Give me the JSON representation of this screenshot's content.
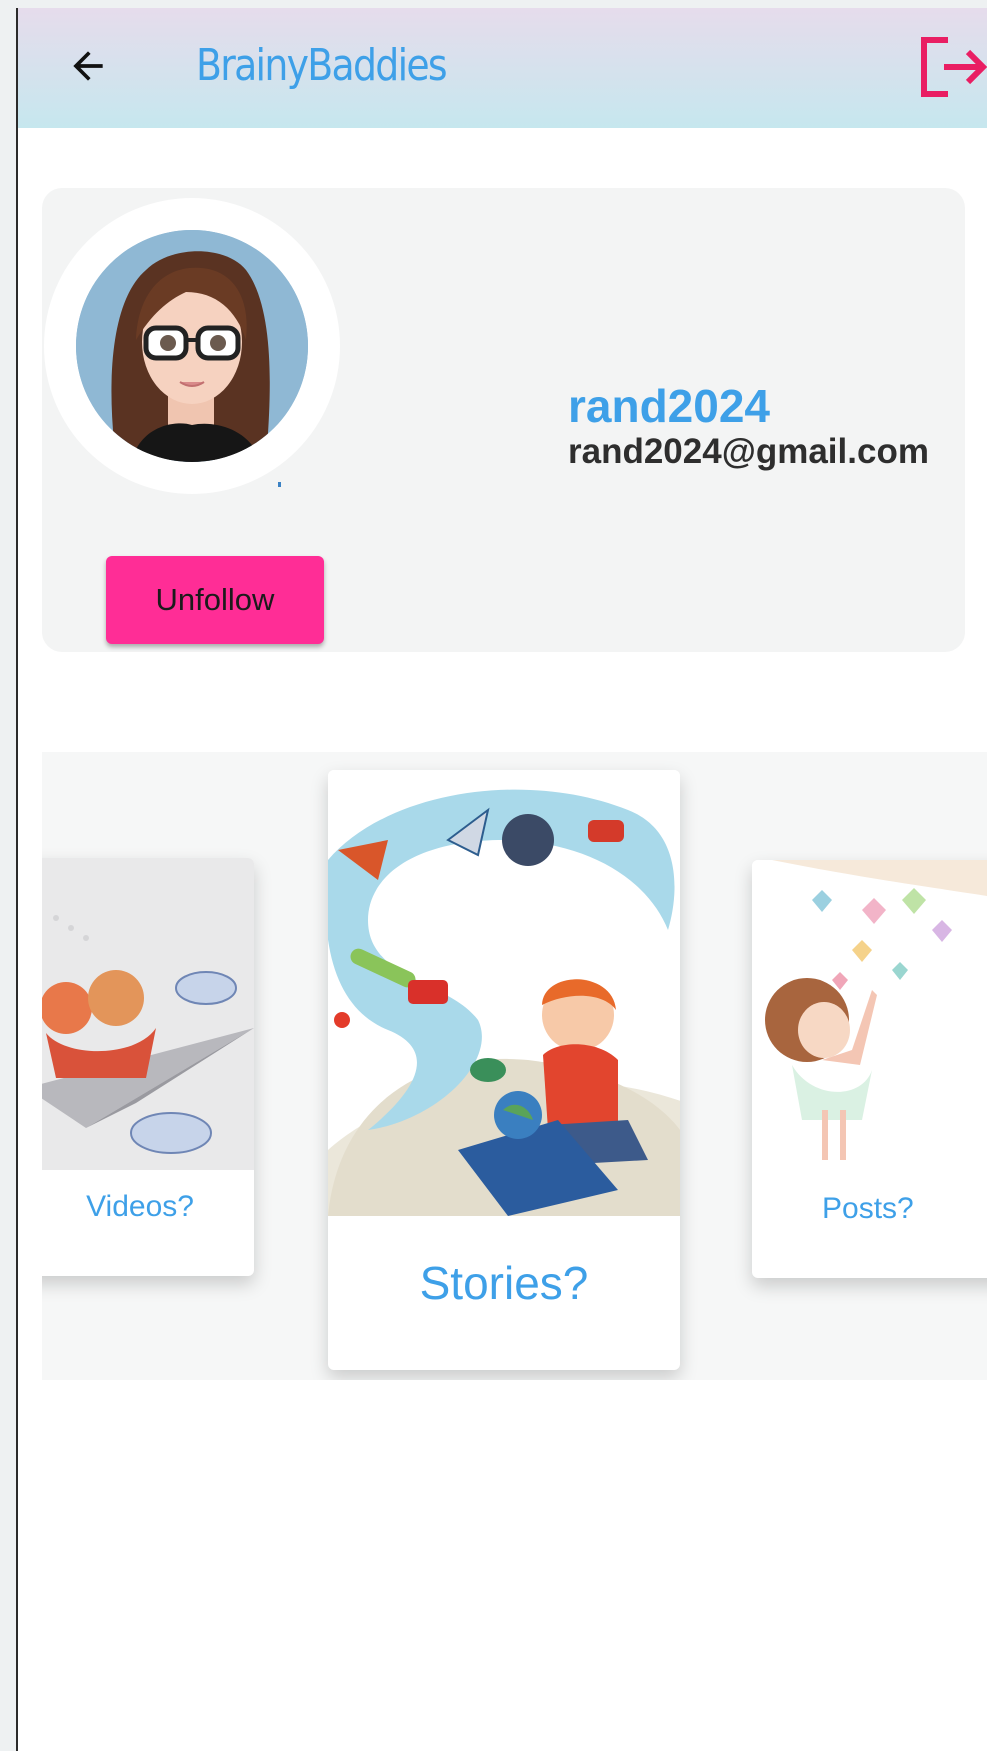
{
  "app": {
    "title": "BrainyBaddies",
    "accent_color": "#3ea0e8",
    "logout_color": "#e91e63"
  },
  "header": {
    "back_icon": "arrow-left-icon",
    "logout_icon": "logout-icon"
  },
  "profile": {
    "username": "rand2024",
    "email": "rand2024@gmail.com",
    "avatar": "cartoon-woman-with-glasses",
    "follow_button_label": "Unfollow",
    "follow_button_color": "#ff2d96"
  },
  "carousel": {
    "tiles": [
      {
        "label": "Videos?",
        "image": "kids-on-paper-plane"
      },
      {
        "label": "Stories?",
        "image": "child-reading-magic-book"
      },
      {
        "label": "Posts?",
        "image": "girl-with-hearts"
      }
    ]
  }
}
